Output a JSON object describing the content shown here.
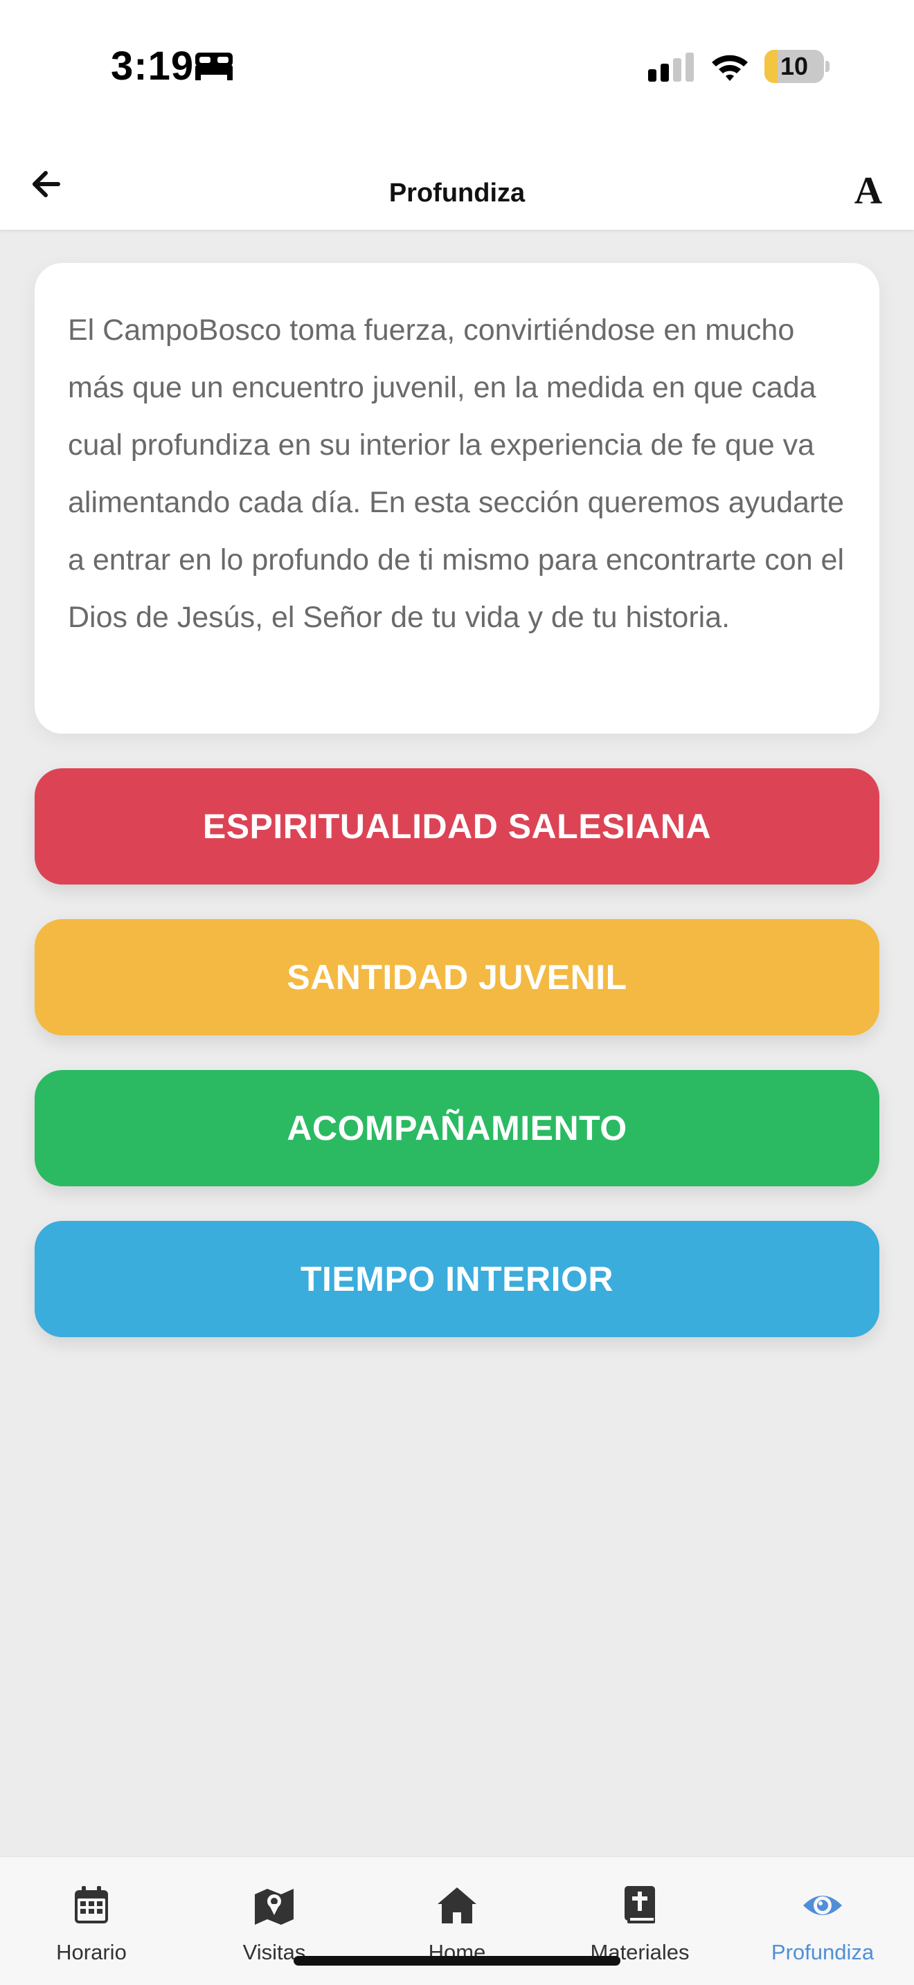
{
  "status_bar": {
    "time": "3:19",
    "battery_level": "10",
    "battery_fraction": 0.1,
    "icons": [
      "bed-icon",
      "cellular-signal-icon",
      "wifi-icon",
      "battery-icon"
    ]
  },
  "header": {
    "title": "Profundiza",
    "back_icon": "arrow-left-icon",
    "font_size_icon": "font-size-icon",
    "font_glyph": "A"
  },
  "intro": {
    "text": "El CampoBosco toma fuerza, convirtiéndose en mucho más que un encuentro juvenil, en la medida en que cada cual profundiza en su interior la experiencia de fe que va alimentando cada día. En esta sección queremos ayudarte a entrar en lo profundo de ti mismo para encontrarte con el Dios de Jesús, el Señor de tu vida y de tu historia."
  },
  "sections": [
    {
      "label": "ESPIRITUALIDAD SALESIANA",
      "color": "#dc4455"
    },
    {
      "label": "SANTIDAD JUVENIL",
      "color": "#f4b942"
    },
    {
      "label": "ACOMPAÑAMIENTO",
      "color": "#2bba62"
    },
    {
      "label": "TIEMPO INTERIOR",
      "color": "#3aaddc"
    }
  ],
  "tab_bar": {
    "items": [
      {
        "label": "Horario",
        "icon": "calendar-icon"
      },
      {
        "label": "Visitas",
        "icon": "map-icon"
      },
      {
        "label": "Home",
        "icon": "home-icon"
      },
      {
        "label": "Materiales",
        "icon": "bible-icon"
      },
      {
        "label": "Profundiza",
        "icon": "eye-icon",
        "active": true
      }
    ],
    "active_color": "#4f8fd8",
    "inactive_color": "#333333"
  }
}
